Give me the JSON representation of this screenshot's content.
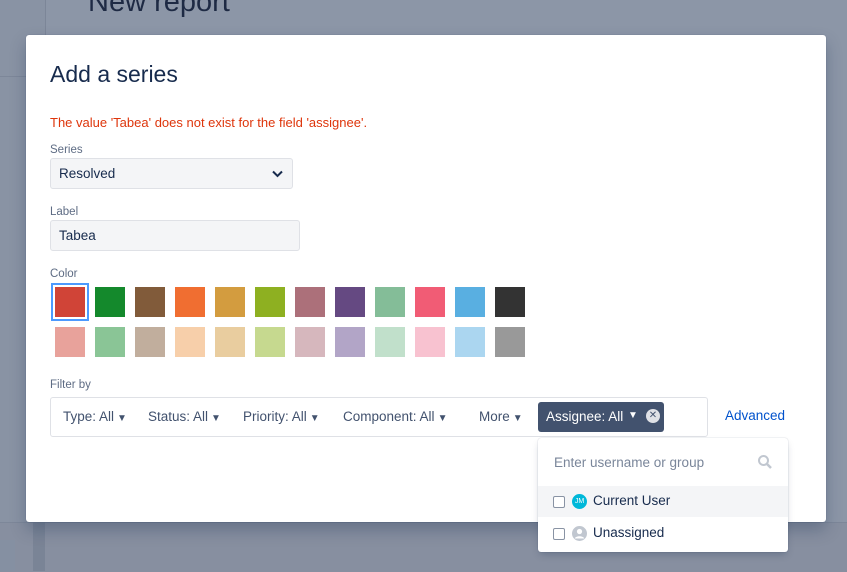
{
  "background": {
    "page_title": "New report"
  },
  "modal": {
    "title": "Add a series",
    "error": "The value 'Tabea' does not exist for the field 'assignee'.",
    "series": {
      "label": "Series",
      "value": "Resolved"
    },
    "label_field": {
      "label": "Label",
      "value": "Tabea"
    },
    "color": {
      "label": "Color",
      "selected_index": 0,
      "row1": [
        "#d04437",
        "#14892c",
        "#815b3a",
        "#f06e31",
        "#d39c3f",
        "#8eb021",
        "#ac707a",
        "#654982",
        "#84bd98",
        "#f15c75",
        "#59afe1",
        "#333333"
      ],
      "row2": [
        "#e8a29b",
        "#8ac596",
        "#c1ae9d",
        "#f7cfaa",
        "#e9cd9f",
        "#c6d98f",
        "#d6b7bd",
        "#b2a5c7",
        "#c1e0cb",
        "#f8c2d0",
        "#abd6f0",
        "#999999"
      ]
    },
    "filter": {
      "label": "Filter by",
      "type": "Type: All",
      "status": "Status: All",
      "priority": "Priority: All",
      "component": "Component: All",
      "more": "More",
      "assignee": "Assignee: All",
      "advanced": "Advanced"
    }
  },
  "assignee_dropdown": {
    "search_placeholder": "Enter username or group",
    "items": [
      {
        "label": "Current User",
        "avatar_initials": "JM"
      },
      {
        "label": "Unassigned"
      }
    ]
  },
  "icons": {
    "caret": "chevron-down-icon",
    "clear": "close-circle-icon",
    "search": "search-icon",
    "avatar": "user-avatar-icon"
  }
}
